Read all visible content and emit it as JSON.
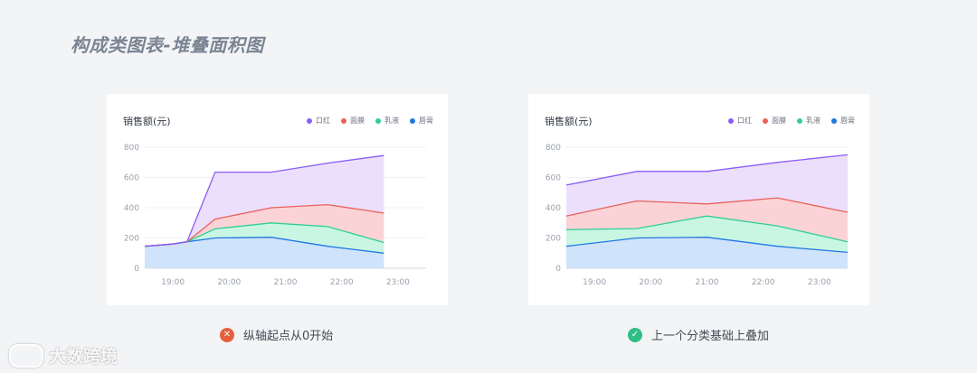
{
  "page_title": "构成类图表-堆叠面积图",
  "captions": {
    "wrong": "纵轴起点从0开始",
    "right": "上一个分类基础上叠加"
  },
  "watermark": "大数跨境",
  "colors": {
    "lipstick": "#8b5cf6",
    "mask": "#e8615a",
    "lotion": "#2fcf93",
    "lipbalm": "#1f78e0",
    "wrong_icon": "#e5603f",
    "right_icon": "#2fbf85"
  },
  "chart_data": [
    {
      "type": "area",
      "variant": "wrong",
      "title": "销售额(元)",
      "x": [
        "18:30",
        "19:00",
        "19:30",
        "20:00",
        "21:00",
        "22:00",
        "23:00",
        "23:30"
      ],
      "xticks": [
        "19:00",
        "20:00",
        "21:00",
        "22:00",
        "23:00"
      ],
      "ylim": [
        0,
        800
      ],
      "yticks": [
        0,
        200,
        400,
        600,
        800
      ],
      "grid": true,
      "legend_position": "top-right",
      "series": [
        {
          "name": "唇膏",
          "color": "#1f78e0",
          "fill": "#cfe3fb",
          "values": [
            145,
            160,
            175,
            200,
            205,
            145,
            100,
            null
          ]
        },
        {
          "name": "乳液",
          "color": "#2fcf93",
          "fill": "#c9f5e3",
          "values": [
            145,
            160,
            175,
            260,
            300,
            275,
            170,
            null
          ]
        },
        {
          "name": "面膜",
          "color": "#e8615a",
          "fill": "#fbd3d6",
          "values": [
            145,
            160,
            175,
            325,
            400,
            420,
            365,
            null
          ]
        },
        {
          "name": "口红",
          "color": "#8b5cf6",
          "fill": "#ebdffc",
          "values": [
            145,
            160,
            175,
            635,
            635,
            695,
            745,
            null
          ]
        }
      ],
      "x_positions": [
        0,
        0.5,
        0.75,
        1.25,
        2.25,
        3.25,
        4.25,
        4.5
      ]
    },
    {
      "type": "area",
      "variant": "right",
      "title": "销售额(元)",
      "x": [
        "18:30",
        "20:00",
        "21:00",
        "22:00",
        "23:30"
      ],
      "xticks": [
        "19:00",
        "20:00",
        "21:00",
        "22:00",
        "23:00"
      ],
      "ylim": [
        0,
        800
      ],
      "yticks": [
        0,
        200,
        400,
        600,
        800
      ],
      "grid": true,
      "legend_position": "top-right",
      "series": [
        {
          "name": "唇膏",
          "color": "#1f78e0",
          "fill": "#cfe3fb",
          "values": [
            145,
            200,
            205,
            145,
            105
          ]
        },
        {
          "name": "乳液",
          "color": "#2fcf93",
          "fill": "#c9f5e3",
          "values": [
            255,
            262,
            345,
            280,
            175
          ]
        },
        {
          "name": "面膜",
          "color": "#e8615a",
          "fill": "#fbd3d6",
          "values": [
            345,
            445,
            425,
            465,
            370
          ]
        },
        {
          "name": "口红",
          "color": "#8b5cf6",
          "fill": "#ebdffc",
          "values": [
            550,
            640,
            640,
            700,
            750
          ]
        }
      ]
    }
  ],
  "legend": [
    {
      "name": "口红",
      "color": "#8b5cf6"
    },
    {
      "name": "面膜",
      "color": "#e8615a"
    },
    {
      "name": "乳液",
      "color": "#2fcf93"
    },
    {
      "name": "唇膏",
      "color": "#1f78e0"
    }
  ]
}
